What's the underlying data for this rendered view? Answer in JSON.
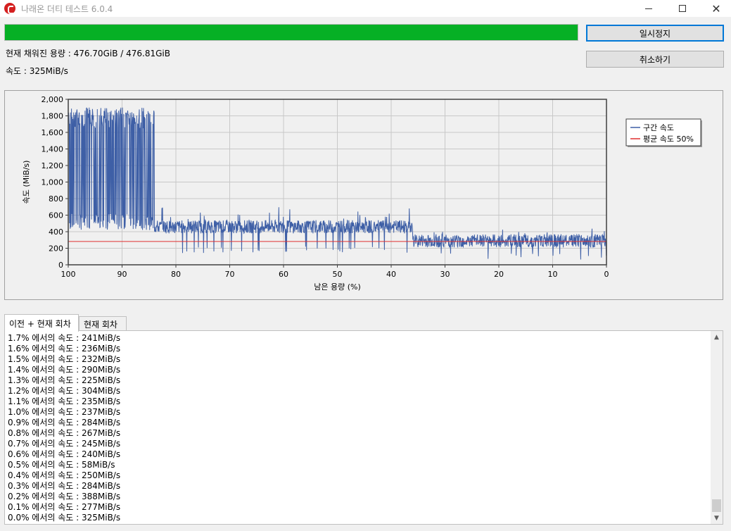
{
  "window": {
    "title": "나래온 더티 테스트 6.0.4",
    "app_icon": "app-logo-icon",
    "close_symbol": "✕"
  },
  "progress": {
    "value": 0.9998,
    "color": "#06b025"
  },
  "buttons": {
    "pause_label": "일시정지",
    "cancel_label": "취소하기"
  },
  "status": {
    "capacity_text": "현재 채워진 용량 : 476.70GiB / 476.81GiB",
    "speed_text": "속도 : 325MiB/s"
  },
  "chart_data": {
    "type": "line",
    "xlabel": "남은 용량 (%)",
    "ylabel": "속도 (MiB/s)",
    "xlim": [
      100,
      0
    ],
    "ylim": [
      0,
      2000
    ],
    "x_ticks": [
      "100",
      "90",
      "80",
      "70",
      "60",
      "50",
      "40",
      "30",
      "20",
      "10",
      "0"
    ],
    "y_ticks": [
      "0",
      "200",
      "400",
      "600",
      "800",
      "1,000",
      "1,200",
      "1,400",
      "1,600",
      "1,800",
      "2,000"
    ],
    "grid": true,
    "legend_position": "right",
    "series": [
      {
        "name": "구간 속도",
        "color": "#3e5fa6",
        "segments": [
          {
            "from": 100,
            "to": 84.8,
            "base": 560,
            "peak": 1900,
            "low": 420
          },
          {
            "from": 84.8,
            "to": 84.0,
            "base": 500,
            "peak": 1900,
            "low": 420
          },
          {
            "from": 84.0,
            "to": 36.0,
            "base": 460,
            "peak": 700,
            "low": 140
          },
          {
            "from": 36.0,
            "to": 0,
            "base": 290,
            "peak": 450,
            "low": 60
          }
        ]
      },
      {
        "name": "평균 속도 50%",
        "color": "#e03030",
        "value": 282
      }
    ]
  },
  "tabs": [
    {
      "label": "이전 + 현재 회차",
      "active": true
    },
    {
      "label": "현재 회차",
      "active": false
    }
  ],
  "log": [
    "1.7% 에서의 속도 : 241MiB/s",
    "1.6% 에서의 속도 : 236MiB/s",
    "1.5% 에서의 속도 : 232MiB/s",
    "1.4% 에서의 속도 : 290MiB/s",
    "1.3% 에서의 속도 : 225MiB/s",
    "1.2% 에서의 속도 : 304MiB/s",
    "1.1% 에서의 속도 : 235MiB/s",
    "1.0% 에서의 속도 : 237MiB/s",
    "0.9% 에서의 속도 : 284MiB/s",
    "0.8% 에서의 속도 : 267MiB/s",
    "0.7% 에서의 속도 : 245MiB/s",
    "0.6% 에서의 속도 : 240MiB/s",
    "0.5% 에서의 속도 : 58MiB/s",
    "0.4% 에서의 속도 : 250MiB/s",
    "0.3% 에서의 속도 : 284MiB/s",
    "0.2% 에서의 속도 : 388MiB/s",
    "0.1% 에서의 속도 : 277MiB/s",
    "0.0% 에서의 속도 : 325MiB/s"
  ]
}
